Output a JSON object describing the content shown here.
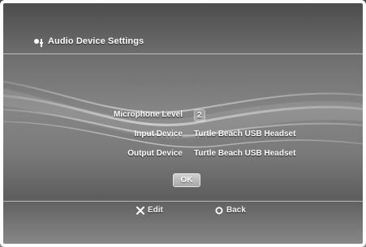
{
  "header": {
    "icon": "settings-icon",
    "title": "Audio Device Settings"
  },
  "meter": {
    "icon": "level-meter",
    "segments": 30,
    "level": 0
  },
  "settings": {
    "microphone_level": {
      "label": "Microphone Level",
      "value": "2"
    },
    "input_device": {
      "label": "Input Device",
      "value": "Turtle Beach USB Headset"
    },
    "output_device": {
      "label": "Output Device",
      "value": "Turtle Beach USB Headset"
    }
  },
  "ok_button": {
    "label": "OK"
  },
  "footer": {
    "edit": {
      "icon": "cross-button-icon",
      "label": "Edit"
    },
    "back": {
      "icon": "circle-button-icon",
      "label": "Back"
    }
  },
  "colors": {
    "text": "#ffffff",
    "background_dark": "#4a4a4a",
    "background_mid": "#858585"
  }
}
